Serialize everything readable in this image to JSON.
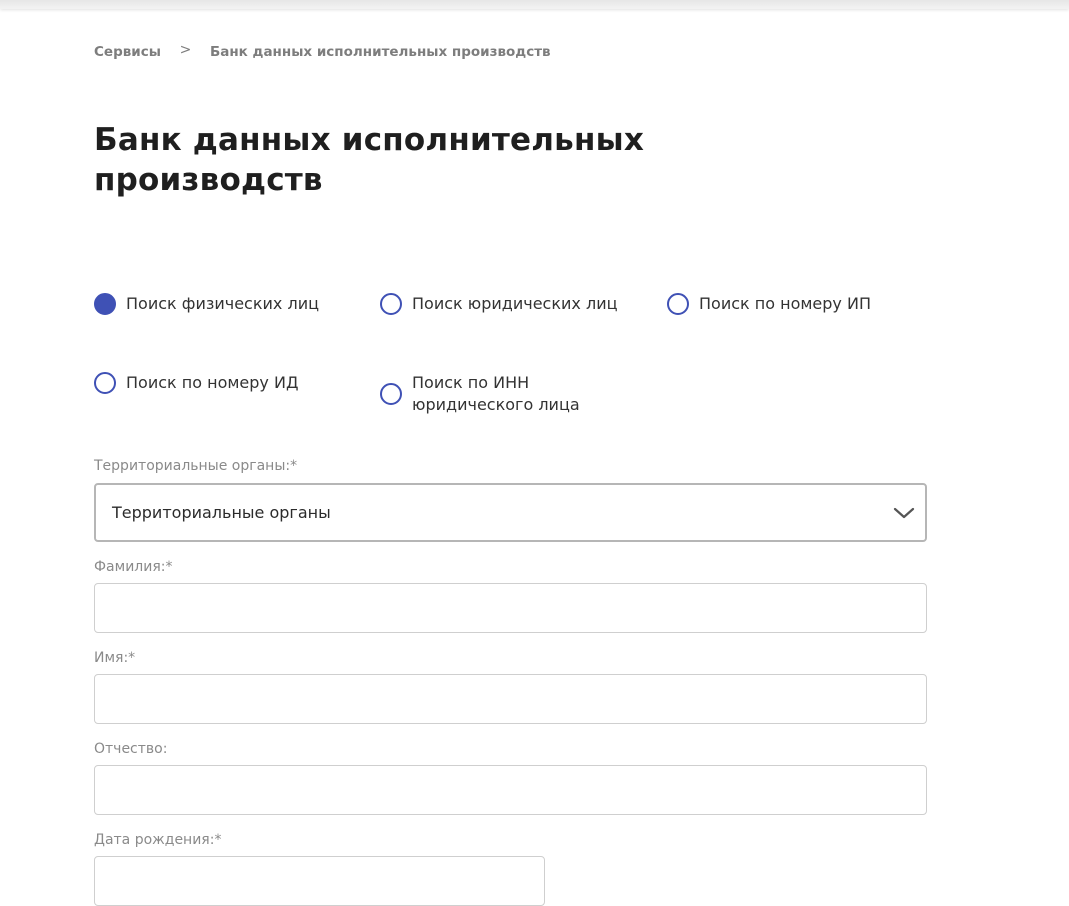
{
  "breadcrumb": {
    "items": [
      "Сервисы",
      "Банк данных исполнительных производств"
    ],
    "separator": ">"
  },
  "page": {
    "title": "Банк данных исполнительных производств"
  },
  "search_type": {
    "options": [
      {
        "label": "Поиск физических лиц",
        "selected": true
      },
      {
        "label": "Поиск юридических лиц",
        "selected": false
      },
      {
        "label": "Поиск по номеру ИП",
        "selected": false
      },
      {
        "label": "Поиск по номеру ИД",
        "selected": false
      },
      {
        "label": "Поиск по ИНН\nюридического лица",
        "selected": false
      }
    ]
  },
  "form": {
    "territorial": {
      "label": "Территориальные органы:*",
      "value": "Территориальные органы"
    },
    "surname": {
      "label": "Фамилия:*",
      "value": ""
    },
    "name": {
      "label": "Имя:*",
      "value": ""
    },
    "patronymic": {
      "label": "Отчество:",
      "value": ""
    },
    "birthdate": {
      "label": "Дата рождения:*",
      "value": ""
    }
  },
  "colors": {
    "accent": "#3f51b5",
    "border": "#cfcfcf",
    "label": "#8a8a8a"
  },
  "icons": {
    "select_chevron": "chevron-down-icon",
    "breadcrumb_separator": "chevron-right-icon"
  }
}
